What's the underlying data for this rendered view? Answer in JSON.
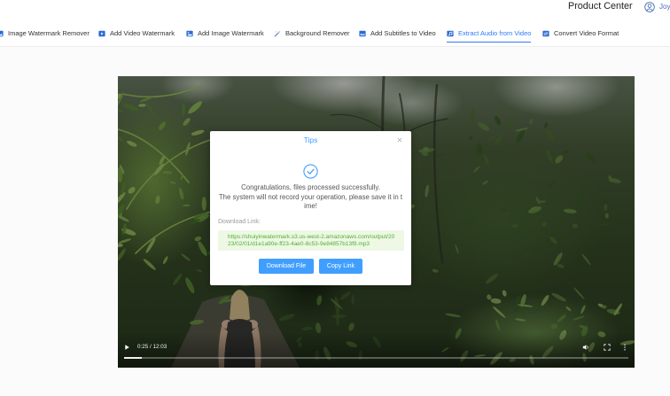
{
  "header": {
    "product_center_label": "Product Center",
    "user_icon": "user-icon",
    "user_name": "Joy"
  },
  "nav": {
    "items": [
      {
        "label": "Image Watermark Remover",
        "icon": "image-icon",
        "active": false
      },
      {
        "label": "Add Video Watermark",
        "icon": "video-icon",
        "active": false
      },
      {
        "label": "Add Image Watermark",
        "icon": "image-icon",
        "active": false
      },
      {
        "label": "Background Remover",
        "icon": "magic-wand-icon",
        "active": false
      },
      {
        "label": "Add Subtitles to Video",
        "icon": "subtitle-icon",
        "active": false
      },
      {
        "label": "Extract Audio from Video",
        "icon": "audio-icon",
        "active": true
      },
      {
        "label": "Convert Video Format",
        "icon": "convert-icon",
        "active": false
      }
    ]
  },
  "video_player": {
    "time_display": "0:25 / 12:03",
    "progress_fraction": 0.035,
    "controls": [
      "play-icon",
      "volume-icon",
      "fullscreen-icon",
      "more-icon"
    ]
  },
  "dialog": {
    "title": "Tips",
    "close_icon": "close-icon",
    "status_icon": "success-check-icon",
    "success_message": "Congratulations, files processed successfully.",
    "notice_message": "The system will not record your operation, please save it in time!",
    "download_link_label": "Download Link:",
    "download_link": "https://shuiyinwatermark.s3.us-west-2.amazonaws.com/output/2023/02/01/d1e1a90e-ff23-4ae0-8c53-9e84857b13f9.mp3",
    "download_button": "Download File",
    "copy_button": "Copy Link"
  },
  "colors": {
    "accent": "#409eff",
    "nav_active": "#2f7cf6",
    "link_text": "#4fb030",
    "link_background": "#eef8e5"
  }
}
